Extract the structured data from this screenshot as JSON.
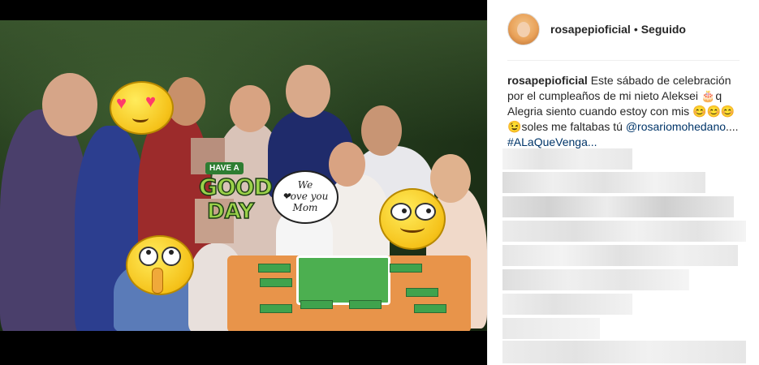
{
  "post": {
    "username": "rosapepioficial",
    "separator": "•",
    "follow_status": "Seguido",
    "caption": {
      "username": "rosapepioficial",
      "text_part1": "Este sábado de celebración por el cumpleaños de mi nieto Aleksei",
      "emoji1": "🎂",
      "text_part2": "q Alegria siento cuando estoy con mis",
      "emoji2": "😊😊😊😉",
      "text_part3": "soles me faltabas tú",
      "mention": "@rosariomohedano",
      "ellipsis": "....",
      "hashtag": "#ALaQueVenga..."
    }
  },
  "photo": {
    "sticker_day": {
      "line1": "HAVE A",
      "line2": "GOOD",
      "line3": "DAY"
    },
    "sticker_love": {
      "line1": "We",
      "line2": "❤ove you",
      "line3": "Mom"
    }
  }
}
